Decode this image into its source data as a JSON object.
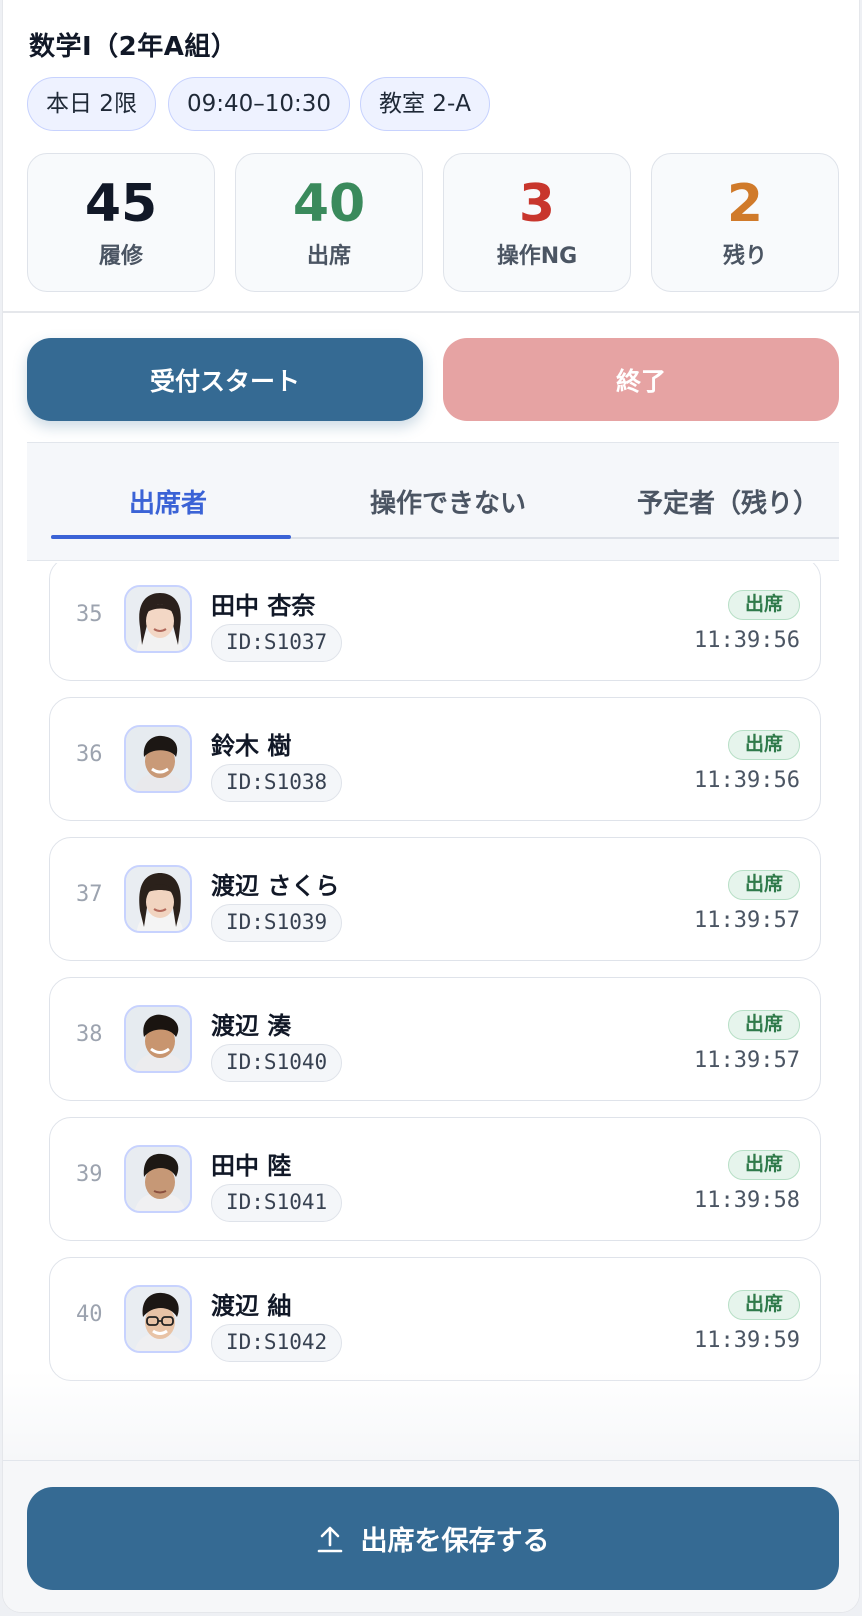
{
  "header": {
    "title": "数学I（2年A組）",
    "chips": [
      "本日 2限",
      "09:40–10:30",
      "教室 2-A"
    ]
  },
  "stats": [
    {
      "value": "45",
      "label": "履修",
      "color": "#111827"
    },
    {
      "value": "40",
      "label": "出席",
      "color": "#3a8a5c"
    },
    {
      "value": "3",
      "label": "操作NG",
      "color": "#c8362d"
    },
    {
      "value": "2",
      "label": "残り",
      "color": "#d07a2a"
    }
  ],
  "actions": {
    "start_label": "受付スタート",
    "end_label": "終了"
  },
  "tabs": [
    {
      "label": "出席者",
      "active": true
    },
    {
      "label": "操作できない",
      "active": false
    },
    {
      "label": "予定者（残り）",
      "active": false
    }
  ],
  "rows": [
    {
      "index": "35",
      "name": "田中 杏奈",
      "id": "ID:S1037",
      "status": "出席",
      "time": "11:39:56"
    },
    {
      "index": "36",
      "name": "鈴木 樹",
      "id": "ID:S1038",
      "status": "出席",
      "time": "11:39:56"
    },
    {
      "index": "37",
      "name": "渡辺 さくら",
      "id": "ID:S1039",
      "status": "出席",
      "time": "11:39:57"
    },
    {
      "index": "38",
      "name": "渡辺 湊",
      "id": "ID:S1040",
      "status": "出席",
      "time": "11:39:57"
    },
    {
      "index": "39",
      "name": "田中 陸",
      "id": "ID:S1041",
      "status": "出席",
      "time": "11:39:58"
    },
    {
      "index": "40",
      "name": "渡辺 紬",
      "id": "ID:S1042",
      "status": "出席",
      "time": "11:39:59"
    }
  ],
  "footer": {
    "save_label": "出席を保存する",
    "save_icon": "upload-icon"
  }
}
